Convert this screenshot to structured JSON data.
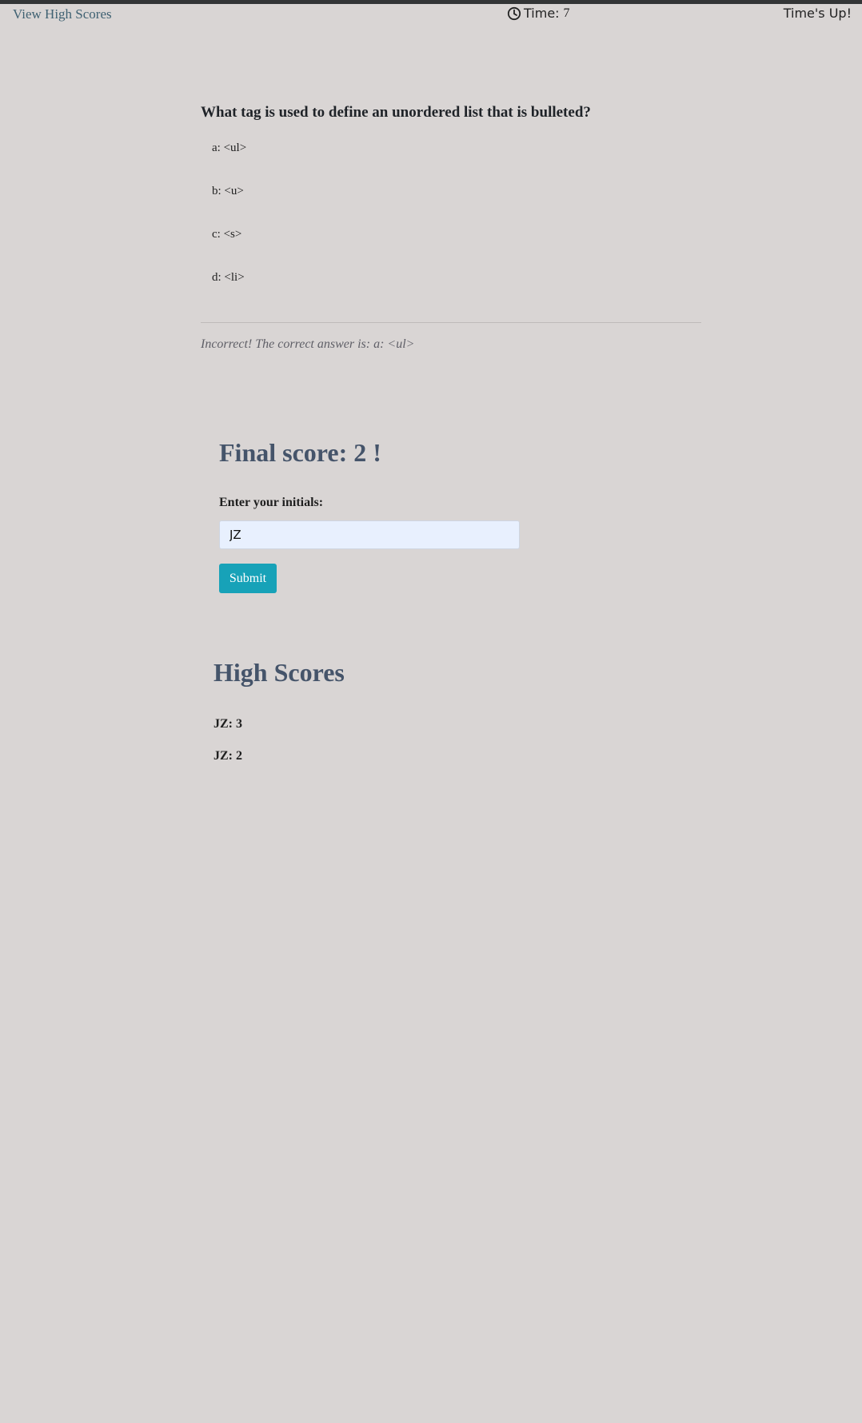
{
  "header": {
    "view_high_scores": "View High Scores",
    "timer_label": "Time:",
    "timer_value": "7",
    "timer_icon": "clock-icon",
    "status": "Time's Up!"
  },
  "quiz": {
    "question": "What tag is used to define an unordered list that is bulleted?",
    "choices": [
      "a: <ul>",
      "b: <u>",
      "c: <s>",
      "d: <li>"
    ],
    "feedback": "Incorrect! The correct answer is: a: <ul>"
  },
  "final": {
    "score_text": "Final score: 2 !",
    "initials_label": "Enter your initials:",
    "initials_value": "JZ",
    "submit_label": "Submit"
  },
  "high_scores": {
    "title": "High Scores",
    "entries": [
      "JZ: 3",
      "JZ: 2"
    ]
  },
  "colors": {
    "background": "#d9d5d4",
    "link": "#3f6172",
    "heading": "#45546a",
    "button": "#17a2b8",
    "input_bg": "#e8f0fe"
  }
}
